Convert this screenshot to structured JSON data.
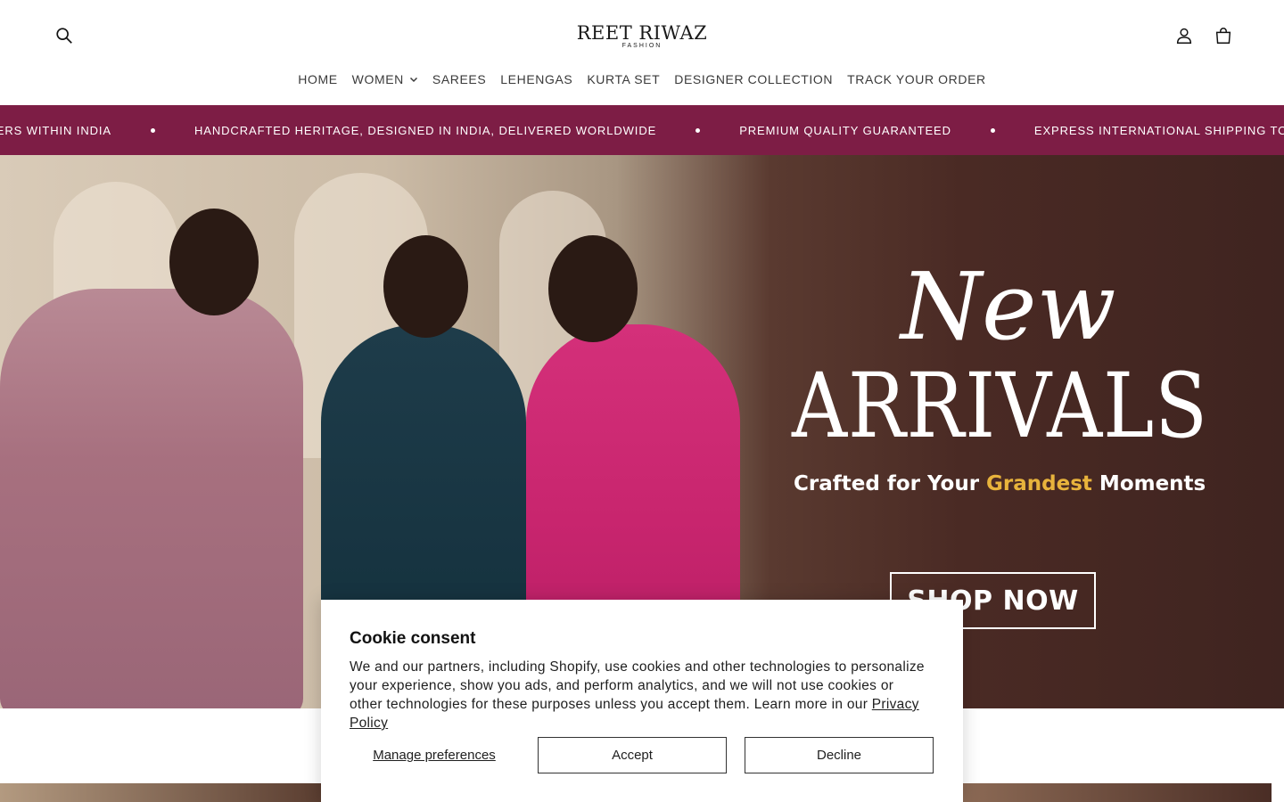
{
  "header": {
    "logo_main": "REET RIWAZ",
    "logo_sub": "FASHION",
    "icons": {
      "search": "search-icon",
      "account": "user-icon",
      "cart": "bag-icon"
    }
  },
  "nav": {
    "items": [
      {
        "label": "HOME"
      },
      {
        "label": "WOMEN",
        "has_dropdown": true
      },
      {
        "label": "SAREES"
      },
      {
        "label": "LEHENGAS"
      },
      {
        "label": "KURTA SET"
      },
      {
        "label": "DESIGNER COLLECTION"
      },
      {
        "label": "TRACK YOUR ORDER"
      }
    ]
  },
  "announcement": {
    "messages": [
      "L ORDERS WITHIN INDIA",
      "HANDCRAFTED HERITAGE, DESIGNED IN INDIA, DELIVERED WORLDWIDE",
      "PREMIUM QUALITY GUARANTEED",
      "EXPRESS INTERNATIONAL SHIPPING TO USA, UK, UAE &"
    ],
    "background": "#7d1d45"
  },
  "hero": {
    "line1": "New",
    "line2": "ARRIVALS",
    "tagline_pre": "Crafted for Your ",
    "tagline_highlight": "Grandest",
    "tagline_post": " Moments",
    "cta": "SHOP NOW",
    "highlight_color": "#e8b33c"
  },
  "cookie": {
    "title": "Cookie consent",
    "body": "We and our partners, including Shopify, use cookies and other technologies to personalize your experience, show you ads, and perform analytics, and we will not use cookies or other technologies for these purposes unless you accept them. Learn more in our ",
    "link": "Privacy Policy",
    "manage": "Manage preferences",
    "accept": "Accept",
    "decline": "Decline"
  }
}
